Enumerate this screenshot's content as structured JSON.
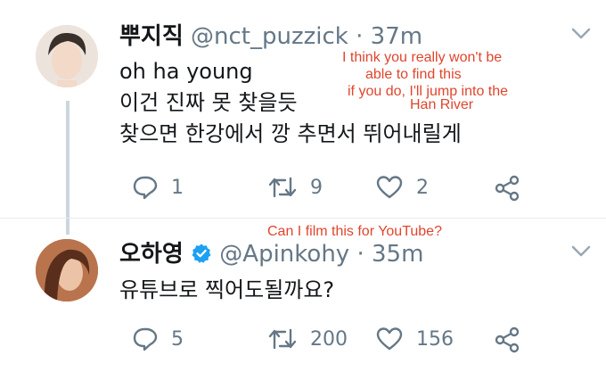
{
  "tweets": [
    {
      "display_name": "뿌지직",
      "handle": "@nct_puzzick",
      "time": "37m",
      "verified": false,
      "lines": [
        "oh ha young",
        "이건 진짜 못 찾을듯",
        "찾으면 한강에서 깡 추면서 뛰어내릴게"
      ],
      "annotation_lines": [
        "I think you really won't be",
        "able to find this",
        "if you do, I'll jump into the",
        "Han River"
      ],
      "actions": {
        "replies": "1",
        "retweets": "9",
        "likes": "2"
      }
    },
    {
      "display_name": "오하영",
      "handle": "@Apinkohy",
      "time": "35m",
      "verified": true,
      "lines": [
        "유튜브로 찍어도될까요?"
      ],
      "annotation_lines": [
        "Can I film this for YouTube?"
      ],
      "actions": {
        "replies": "5",
        "retweets": "200",
        "likes": "156"
      }
    }
  ],
  "icons": {
    "reply": "reply-icon",
    "retweet": "retweet-icon",
    "like": "heart-icon",
    "share": "share-icon",
    "menu": "chevron-down-icon",
    "verified": "verified-badge-icon"
  },
  "colors": {
    "handle": "#657786",
    "annotation": "#e0452d",
    "verified": "#1da1f2",
    "icon": "#657786"
  }
}
